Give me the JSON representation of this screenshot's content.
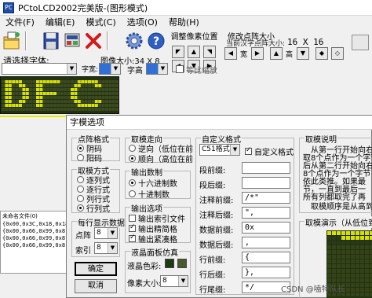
{
  "app": {
    "title": "PCtoLCD2002完美版-(图形模式)",
    "icon_text": "PC"
  },
  "menu": [
    {
      "label": "文件(F)"
    },
    {
      "label": "编辑(E)"
    },
    {
      "label": "模式(C)"
    },
    {
      "label": "选项(O)"
    },
    {
      "label": "帮助(H)"
    }
  ],
  "toolbar": {
    "icons": [
      "folder-icon",
      "save-icon",
      "settings-icon",
      "close-icon",
      "gear-icon",
      "help-icon"
    ]
  },
  "position_group": {
    "title": "调整像素位置"
  },
  "size_group": {
    "title": "修改点阵大小",
    "subtitle": "当前汉字点阵大小:",
    "values": "16 X 16",
    "width_label": "宽",
    "height_label": "高"
  },
  "font_row": {
    "label": "请选择字体:",
    "image_size": "图像大小:34 X 8",
    "char_width_label": "字宽:",
    "char_height_label": "字高",
    "proportional_label": "等比缩放"
  },
  "code_panel": {
    "title": "未命名文件(0)",
    "lines": [
      "{0x00,0x3C,0x18,0x18,0x",
      "{0x00,0x66,0x99,0x81,0x",
      "{0x00,0x66,0x99,0x81,0x",
      "{0x00,0x66,0x99,0x81,0x"
    ]
  },
  "dialog": {
    "title": "字模选项",
    "dot_format": {
      "title": "点阵格式",
      "options": [
        "阴码",
        "阳码"
      ],
      "selected": 0
    },
    "mode": {
      "title": "取模方式",
      "options": [
        "逐列式",
        "逐行式",
        "列行式",
        "行列式"
      ],
      "selected": 3
    },
    "per_row": {
      "title": "每行显示数据",
      "dots_label": "点阵",
      "dots_value": "8",
      "index_label": "索引",
      "index_value": "8"
    },
    "confirm_label": "确定",
    "cancel_label": "取消",
    "direction": {
      "title": "取模走向",
      "options": [
        "逆向（低位在前",
        "顺向（高位在前"
      ],
      "selected": 1
    },
    "output_base": {
      "title": "输出数制",
      "options": [
        "十六进制数",
        "十进制数"
      ],
      "selected": 0
    },
    "output_options": {
      "title": "输出选项",
      "options": [
        {
          "label": "输出索引文件",
          "checked": false
        },
        {
          "label": "输出精简格",
          "checked": true
        },
        {
          "label": "输出紧凑格",
          "checked": true
        }
      ]
    },
    "lcd_sim": {
      "title": "液晶面板仿真",
      "color_label": "液晶色彩:",
      "pixel_label": "像素大小:",
      "pixel_value": "8",
      "color_on": "#1f3a12",
      "color_off": "#4a5a2a"
    },
    "custom_format": {
      "title": "自定义格式",
      "format_value": "C51格式",
      "custom_checkbox": "自定义格式",
      "custom_checked": true,
      "rows": [
        {
          "label": "段前缀:",
          "value": ""
        },
        {
          "label": "段后缀:",
          "value": ""
        },
        {
          "label": "注释前缀:",
          "value": "/*\""
        },
        {
          "label": "注释后缀:",
          "value": "\","
        },
        {
          "label": "数据前缀:",
          "value": "0x"
        },
        {
          "label": "数据后缀:",
          "value": ","
        },
        {
          "label": "行前缀:",
          "value": "{"
        },
        {
          "label": "行后缀:",
          "value": "},"
        },
        {
          "label": "行尾缀:",
          "value": "*/"
        }
      ]
    },
    "description": {
      "title": "取模说明",
      "lines": [
        "从第一行开始向右",
        "取8个点作为一个字节",
        "后从第二行开始向右",
        "8个点作为一个字节",
        "依此类推。如果最",
        "节，一直到最后一",
        "所有列都取完了再",
        "取模顺序是从高到"
      ],
      "demo_title": "取模演示（从低位到"
    }
  },
  "watermark": "CSDN @嗑特队长",
  "colors": {
    "led_bg": "#22310f",
    "led_on": "#d8e000",
    "led_off": "#3b4a20",
    "border_yellow": "#e8e800",
    "accent_blue": "#1d4ea8"
  }
}
